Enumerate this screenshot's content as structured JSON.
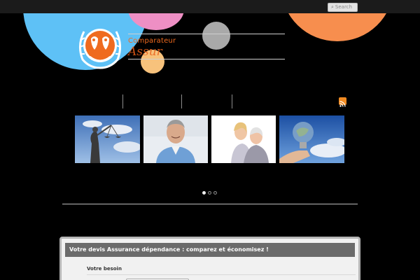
{
  "search": {
    "placeholder": "Search",
    "icon": "search-icon"
  },
  "logo": {
    "tagline": "Comparateur",
    "brand_partial": "Assur"
  },
  "colors": {
    "blue": "#5ec1f6",
    "pink": "#ee8fc4",
    "gray": "#a9a9a9",
    "peach": "#f7c27c",
    "orange": "#f78e4e",
    "logo_orange": "#f06a1e",
    "rss": "#f08a22"
  },
  "nav": {
    "rss_icon": "rss-icon"
  },
  "slider": {
    "slides": [
      {
        "subject": "justice-statue"
      },
      {
        "subject": "smiling-man"
      },
      {
        "subject": "elderly-woman-and-child"
      },
      {
        "subject": "light-bulb"
      }
    ],
    "active_dot": 1,
    "dot_count": 3
  },
  "form": {
    "title": "Votre devis Assurance dépendance : comparez et économisez !",
    "need_label": "Votre besoin"
  }
}
